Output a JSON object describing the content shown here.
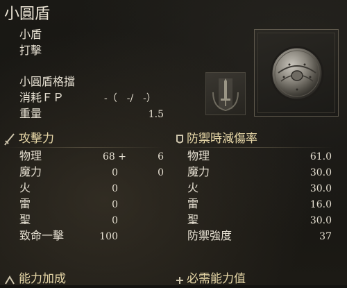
{
  "item": {
    "name": "小圓盾",
    "type": "小盾",
    "attack_type": "打擊",
    "skill": "小圓盾格擋",
    "fp_label": "消耗ＦＰ",
    "fp_value": "-（　-/　-）",
    "weight_label": "重量",
    "weight_value": "1.5"
  },
  "attack_power": {
    "header": "攻擊力",
    "rows": [
      {
        "label": "物理",
        "value": "68 +",
        "bonus": "6"
      },
      {
        "label": "魔力",
        "value": "0"
      },
      {
        "label": "火",
        "value": "0"
      },
      {
        "label": "雷",
        "value": "0"
      },
      {
        "label": "聖",
        "value": "0"
      },
      {
        "label": "致命一擊",
        "value": "100"
      }
    ]
  },
  "guard": {
    "header": "防禦時減傷率",
    "rows": [
      {
        "label": "物理",
        "value": "61.0"
      },
      {
        "label": "魔力",
        "value": "30.0"
      },
      {
        "label": "火",
        "value": "30.0"
      },
      {
        "label": "雷",
        "value": "16.0"
      },
      {
        "label": "聖",
        "value": "30.0"
      },
      {
        "label": "防禦強度",
        "value": "37"
      }
    ]
  },
  "footer": {
    "left_header": "能力加成",
    "right_header": "必需能力值"
  },
  "icons": {
    "attack": "sword-icon",
    "guard": "shield-badge-icon",
    "skill": "sword-skill-icon",
    "item": "round-shield-icon"
  }
}
